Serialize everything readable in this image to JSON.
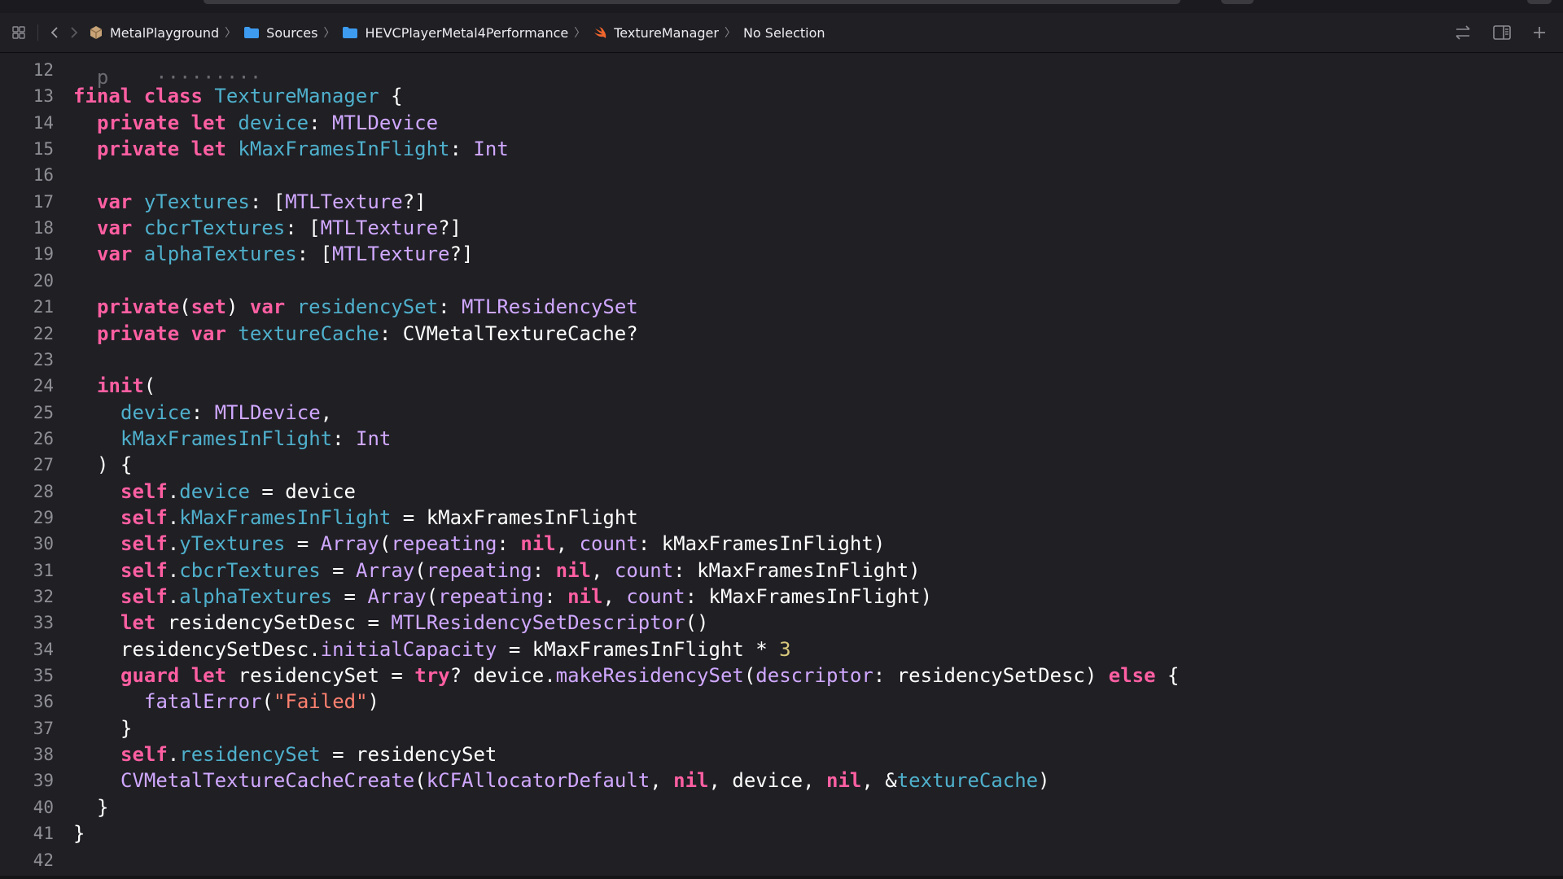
{
  "breadcrumb": {
    "items": [
      {
        "label": "MetalPlayground",
        "icon": "package-icon"
      },
      {
        "label": "Sources",
        "icon": "folder-icon"
      },
      {
        "label": "HEVCPlayerMetal4Performance",
        "icon": "folder-icon"
      },
      {
        "label": "TextureManager",
        "icon": "swift-icon"
      },
      {
        "label": "No Selection",
        "icon": ""
      }
    ]
  },
  "toolbar": {
    "left_icons": [
      "grid-icon",
      "back-icon",
      "forward-icon"
    ],
    "right_icons": [
      "swap-icon",
      "inspector-icon",
      "add-icon"
    ]
  },
  "colors": {
    "background": "#1f1f24",
    "keyword": "#ff5fa2",
    "identifier": "#4fb0cc",
    "type": "#d0a8ff",
    "string": "#ff8170",
    "number": "#d9c97c",
    "line_number": "#8f8f96"
  },
  "code_lines": [
    {
      "n": "12",
      "indent": 0,
      "tokens": []
    },
    {
      "n": "13",
      "indent": 0,
      "tokens": [
        [
          "kw",
          "final"
        ],
        [
          "pl",
          " "
        ],
        [
          "kw",
          "class"
        ],
        [
          "pl",
          " "
        ],
        [
          "fn",
          "TextureManager"
        ],
        [
          "pl",
          " {"
        ]
      ]
    },
    {
      "n": "14",
      "indent": 1,
      "tokens": [
        [
          "kw",
          "private"
        ],
        [
          "pl",
          " "
        ],
        [
          "kw",
          "let"
        ],
        [
          "pl",
          " "
        ],
        [
          "fn",
          "device"
        ],
        [
          "pl",
          ": "
        ],
        [
          "ty",
          "MTLDevice"
        ]
      ]
    },
    {
      "n": "15",
      "indent": 1,
      "tokens": [
        [
          "kw",
          "private"
        ],
        [
          "pl",
          " "
        ],
        [
          "kw",
          "let"
        ],
        [
          "pl",
          " "
        ],
        [
          "fn",
          "kMaxFramesInFlight"
        ],
        [
          "pl",
          ": "
        ],
        [
          "ty",
          "Int"
        ]
      ]
    },
    {
      "n": "16",
      "indent": 0,
      "tokens": []
    },
    {
      "n": "17",
      "indent": 1,
      "tokens": [
        [
          "kw",
          "var"
        ],
        [
          "pl",
          " "
        ],
        [
          "fn",
          "yTextures"
        ],
        [
          "pl",
          ": ["
        ],
        [
          "ty",
          "MTLTexture"
        ],
        [
          "pl",
          "?]"
        ]
      ]
    },
    {
      "n": "18",
      "indent": 1,
      "tokens": [
        [
          "kw",
          "var"
        ],
        [
          "pl",
          " "
        ],
        [
          "fn",
          "cbcrTextures"
        ],
        [
          "pl",
          ": ["
        ],
        [
          "ty",
          "MTLTexture"
        ],
        [
          "pl",
          "?]"
        ]
      ]
    },
    {
      "n": "19",
      "indent": 1,
      "tokens": [
        [
          "kw",
          "var"
        ],
        [
          "pl",
          " "
        ],
        [
          "fn",
          "alphaTextures"
        ],
        [
          "pl",
          ": ["
        ],
        [
          "ty",
          "MTLTexture"
        ],
        [
          "pl",
          "?]"
        ]
      ]
    },
    {
      "n": "20",
      "indent": 0,
      "tokens": []
    },
    {
      "n": "21",
      "indent": 1,
      "tokens": [
        [
          "kw",
          "private"
        ],
        [
          "pl",
          "("
        ],
        [
          "kw",
          "set"
        ],
        [
          "pl",
          ") "
        ],
        [
          "kw",
          "var"
        ],
        [
          "pl",
          " "
        ],
        [
          "fn",
          "residencySet"
        ],
        [
          "pl",
          ": "
        ],
        [
          "ty",
          "MTLResidencySet"
        ]
      ]
    },
    {
      "n": "22",
      "indent": 1,
      "tokens": [
        [
          "kw",
          "private"
        ],
        [
          "pl",
          " "
        ],
        [
          "kw",
          "var"
        ],
        [
          "pl",
          " "
        ],
        [
          "fn",
          "textureCache"
        ],
        [
          "pl",
          ": CVMetalTextureCache?"
        ]
      ]
    },
    {
      "n": "23",
      "indent": 0,
      "tokens": []
    },
    {
      "n": "24",
      "indent": 1,
      "tokens": [
        [
          "kw",
          "init"
        ],
        [
          "pl",
          "("
        ]
      ]
    },
    {
      "n": "25",
      "indent": 2,
      "tokens": [
        [
          "prm",
          "device"
        ],
        [
          "pl",
          ": "
        ],
        [
          "ty",
          "MTLDevice"
        ],
        [
          "pl",
          ","
        ]
      ]
    },
    {
      "n": "26",
      "indent": 2,
      "tokens": [
        [
          "prm",
          "kMaxFramesInFlight"
        ],
        [
          "pl",
          ": "
        ],
        [
          "ty",
          "Int"
        ]
      ]
    },
    {
      "n": "27",
      "indent": 1,
      "tokens": [
        [
          "pl",
          ") {"
        ]
      ]
    },
    {
      "n": "28",
      "indent": 2,
      "tokens": [
        [
          "kw",
          "self"
        ],
        [
          "pl",
          "."
        ],
        [
          "fn",
          "device"
        ],
        [
          "pl",
          " = device"
        ]
      ]
    },
    {
      "n": "29",
      "indent": 2,
      "tokens": [
        [
          "kw",
          "self"
        ],
        [
          "pl",
          "."
        ],
        [
          "fn",
          "kMaxFramesInFlight"
        ],
        [
          "pl",
          " = kMaxFramesInFlight"
        ]
      ]
    },
    {
      "n": "30",
      "indent": 2,
      "tokens": [
        [
          "kw",
          "self"
        ],
        [
          "pl",
          "."
        ],
        [
          "fn",
          "yTextures"
        ],
        [
          "pl",
          " = "
        ],
        [
          "ty",
          "Array"
        ],
        [
          "pl",
          "("
        ],
        [
          "ty",
          "repeating"
        ],
        [
          "pl",
          ": "
        ],
        [
          "kw",
          "nil"
        ],
        [
          "pl",
          ", "
        ],
        [
          "ty",
          "count"
        ],
        [
          "pl",
          ": kMaxFramesInFlight)"
        ]
      ]
    },
    {
      "n": "31",
      "indent": 2,
      "tokens": [
        [
          "kw",
          "self"
        ],
        [
          "pl",
          "."
        ],
        [
          "fn",
          "cbcrTextures"
        ],
        [
          "pl",
          " = "
        ],
        [
          "ty",
          "Array"
        ],
        [
          "pl",
          "("
        ],
        [
          "ty",
          "repeating"
        ],
        [
          "pl",
          ": "
        ],
        [
          "kw",
          "nil"
        ],
        [
          "pl",
          ", "
        ],
        [
          "ty",
          "count"
        ],
        [
          "pl",
          ": kMaxFramesInFlight)"
        ]
      ]
    },
    {
      "n": "32",
      "indent": 2,
      "tokens": [
        [
          "kw",
          "self"
        ],
        [
          "pl",
          "."
        ],
        [
          "fn",
          "alphaTextures"
        ],
        [
          "pl",
          " = "
        ],
        [
          "ty",
          "Array"
        ],
        [
          "pl",
          "("
        ],
        [
          "ty",
          "repeating"
        ],
        [
          "pl",
          ": "
        ],
        [
          "kw",
          "nil"
        ],
        [
          "pl",
          ", "
        ],
        [
          "ty",
          "count"
        ],
        [
          "pl",
          ": kMaxFramesInFlight)"
        ]
      ]
    },
    {
      "n": "33",
      "indent": 2,
      "tokens": [
        [
          "kw",
          "let"
        ],
        [
          "pl",
          " residencySetDesc = "
        ],
        [
          "ty",
          "MTLResidencySetDescriptor"
        ],
        [
          "pl",
          "()"
        ]
      ]
    },
    {
      "n": "34",
      "indent": 2,
      "tokens": [
        [
          "pl",
          "residencySetDesc."
        ],
        [
          "ty",
          "initialCapacity"
        ],
        [
          "pl",
          " = kMaxFramesInFlight * "
        ],
        [
          "num",
          "3"
        ]
      ]
    },
    {
      "n": "35",
      "indent": 2,
      "tokens": [
        [
          "kw",
          "guard"
        ],
        [
          "pl",
          " "
        ],
        [
          "kw",
          "let"
        ],
        [
          "pl",
          " residencySet = "
        ],
        [
          "kw",
          "try"
        ],
        [
          "pl",
          "? device."
        ],
        [
          "ty",
          "makeResidencySet"
        ],
        [
          "pl",
          "("
        ],
        [
          "ty",
          "descriptor"
        ],
        [
          "pl",
          ": residencySetDesc) "
        ],
        [
          "kw",
          "else"
        ],
        [
          "pl",
          " {"
        ]
      ]
    },
    {
      "n": "36",
      "indent": 3,
      "tokens": [
        [
          "ty",
          "fatalError"
        ],
        [
          "pl",
          "("
        ],
        [
          "str",
          "\"Failed\""
        ],
        [
          "pl",
          ")"
        ]
      ]
    },
    {
      "n": "37",
      "indent": 2,
      "tokens": [
        [
          "pl",
          "}"
        ]
      ]
    },
    {
      "n": "38",
      "indent": 2,
      "tokens": [
        [
          "kw",
          "self"
        ],
        [
          "pl",
          "."
        ],
        [
          "fn",
          "residencySet"
        ],
        [
          "pl",
          " = residencySet"
        ]
      ]
    },
    {
      "n": "39",
      "indent": 2,
      "tokens": [
        [
          "ty",
          "CVMetalTextureCacheCreate"
        ],
        [
          "pl",
          "("
        ],
        [
          "ty",
          "kCFAllocatorDefault"
        ],
        [
          "pl",
          ", "
        ],
        [
          "kw",
          "nil"
        ],
        [
          "pl",
          ", device, "
        ],
        [
          "kw",
          "nil"
        ],
        [
          "pl",
          ", &"
        ],
        [
          "fn",
          "textureCache"
        ],
        [
          "pl",
          ")"
        ]
      ]
    },
    {
      "n": "40",
      "indent": 1,
      "tokens": [
        [
          "pl",
          "}"
        ]
      ]
    },
    {
      "n": "41",
      "indent": 0,
      "tokens": [
        [
          "pl",
          "}"
        ]
      ]
    },
    {
      "n": "42",
      "indent": 0,
      "tokens": []
    }
  ]
}
